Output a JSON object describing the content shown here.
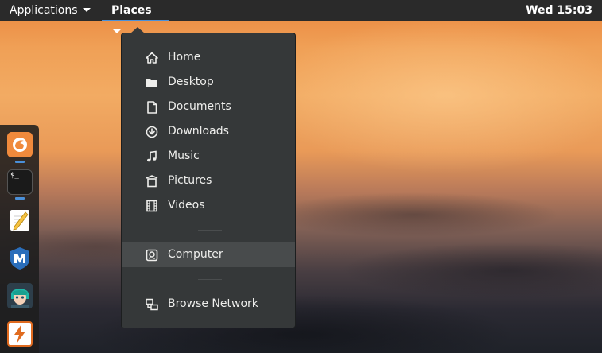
{
  "topbar": {
    "applications_label": "Applications",
    "places_label": "Places",
    "clock": "Wed 15:03"
  },
  "dock": {
    "items": [
      {
        "name": "firefox",
        "icon": "firefox-icon"
      },
      {
        "name": "terminal",
        "icon": "terminal-icon",
        "text": "$_"
      },
      {
        "name": "text-editor",
        "icon": "text-editor-icon"
      },
      {
        "name": "metasploit",
        "icon": "metasploit-icon",
        "text": "M"
      },
      {
        "name": "avatar-app",
        "icon": "anime-avatar-icon"
      },
      {
        "name": "burpsuite",
        "icon": "burpsuite-icon"
      }
    ]
  },
  "places_menu": {
    "items": [
      {
        "label": "Home",
        "icon": "home-icon"
      },
      {
        "label": "Desktop",
        "icon": "desktop-folder-icon"
      },
      {
        "label": "Documents",
        "icon": "document-icon"
      },
      {
        "label": "Downloads",
        "icon": "download-icon"
      },
      {
        "label": "Music",
        "icon": "music-note-icon"
      },
      {
        "label": "Pictures",
        "icon": "pictures-icon"
      },
      {
        "label": "Videos",
        "icon": "film-icon"
      },
      {
        "label": "Computer",
        "icon": "computer-drive-icon",
        "highlighted": true
      },
      {
        "label": "Browse Network",
        "icon": "network-icon"
      }
    ]
  },
  "colors": {
    "topbar_bg": "#2a2a2a",
    "popup_bg": "#353839",
    "hover_bg": "#484b4c",
    "accent": "#4a90d9"
  }
}
